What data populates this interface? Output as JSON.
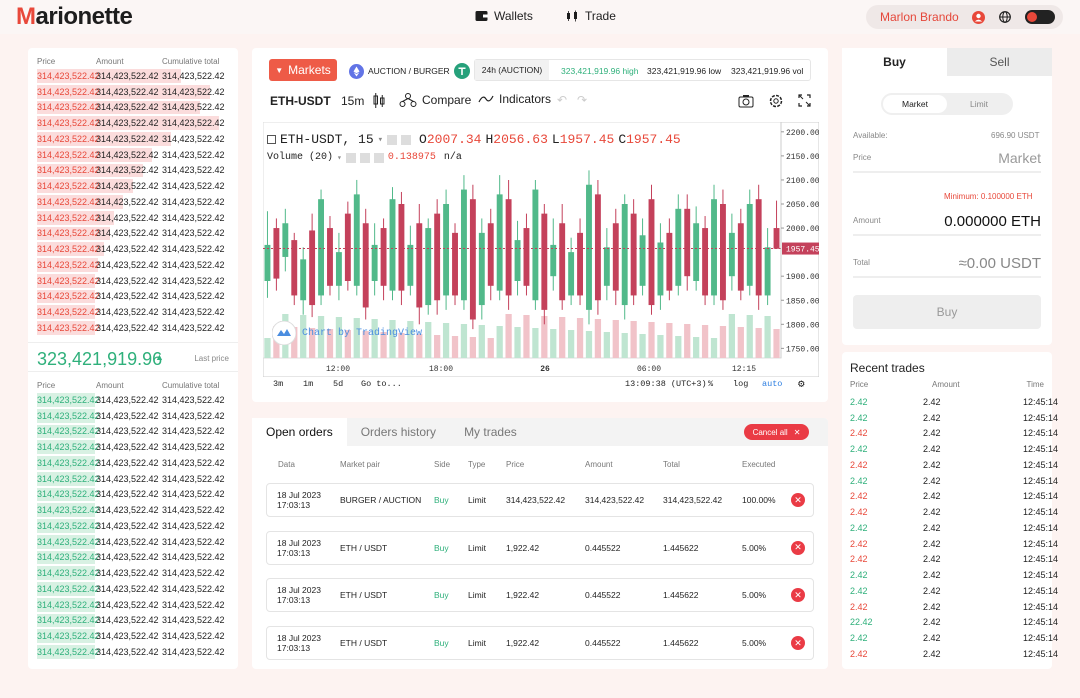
{
  "app": {
    "logo": "Marionette"
  },
  "nav": {
    "wallets": "Wallets",
    "trade": "Trade"
  },
  "user": {
    "name": "Marlon Brando"
  },
  "orderbook": {
    "columns": [
      "Price",
      "Amount",
      "Cumulative total"
    ],
    "asks": [
      {
        "price": "314,423,522.42",
        "amount": "314,423,522.42",
        "total": "314,423,522.42",
        "depth": 0.75
      },
      {
        "price": "314,423,522.42",
        "amount": "314,423,522.42",
        "total": "314,423,522.42",
        "depth": 0.9
      },
      {
        "price": "314,423,522.42",
        "amount": "314,423,522.42",
        "total": "314,423,522.42",
        "depth": 0.85
      },
      {
        "price": "314,423,522.42",
        "amount": "314,423,522.42",
        "total": "314,423,522.42",
        "depth": 0.95
      },
      {
        "price": "314,423,522.42",
        "amount": "314,423,522.42",
        "total": "314,423,522.42",
        "depth": 0.7
      },
      {
        "price": "314,423,522.42",
        "amount": "314,423,522.42",
        "total": "314,423,522.42",
        "depth": 0.6
      },
      {
        "price": "314,423,522.42",
        "amount": "314,423,522.42",
        "total": "314,423,522.42",
        "depth": 0.55
      },
      {
        "price": "314,423,522.42",
        "amount": "314,423,522.42",
        "total": "314,423,522.42",
        "depth": 0.5
      },
      {
        "price": "314,423,522.42",
        "amount": "314,423,522.42",
        "total": "314,423,522.42",
        "depth": 0.45
      },
      {
        "price": "314,423,522.42",
        "amount": "314,423,522.42",
        "total": "314,423,522.42",
        "depth": 0.4
      },
      {
        "price": "314,423,522.42",
        "amount": "314,423,522.42",
        "total": "314,423,522.42",
        "depth": 0.38
      },
      {
        "price": "314,423,522.42",
        "amount": "314,423,522.42",
        "total": "314,423,522.42",
        "depth": 0.35
      },
      {
        "price": "314,423,522.42",
        "amount": "314,423,522.42",
        "total": "314,423,522.42",
        "depth": 0.32
      },
      {
        "price": "314,423,522.42",
        "amount": "314,423,522.42",
        "total": "314,423,522.42",
        "depth": 0.3
      },
      {
        "price": "314,423,522.42",
        "amount": "314,423,522.42",
        "total": "314,423,522.42",
        "depth": 0.3
      },
      {
        "price": "314,423,522.42",
        "amount": "314,423,522.42",
        "total": "314,423,522.42",
        "depth": 0.3
      },
      {
        "price": "314,423,522.42",
        "amount": "314,423,522.42",
        "total": "314,423,522.42",
        "depth": 0.3
      }
    ],
    "last_price": "323,421,919.96",
    "last_price_label": "Last price",
    "bids": [
      {
        "price": "314,423,522.42",
        "amount": "314,423,522.42",
        "total": "314,423,522.42",
        "depth": 0.3
      },
      {
        "price": "314,423,522.42",
        "amount": "314,423,522.42",
        "total": "314,423,522.42",
        "depth": 0.3
      },
      {
        "price": "314,423,522.42",
        "amount": "314,423,522.42",
        "total": "314,423,522.42",
        "depth": 0.3
      },
      {
        "price": "314,423,522.42",
        "amount": "314,423,522.42",
        "total": "314,423,522.42",
        "depth": 0.3
      },
      {
        "price": "314,423,522.42",
        "amount": "314,423,522.42",
        "total": "314,423,522.42",
        "depth": 0.3
      },
      {
        "price": "314,423,522.42",
        "amount": "314,423,522.42",
        "total": "314,423,522.42",
        "depth": 0.3
      },
      {
        "price": "314,423,522.42",
        "amount": "314,423,522.42",
        "total": "314,423,522.42",
        "depth": 0.3
      },
      {
        "price": "314,423,522.42",
        "amount": "314,423,522.42",
        "total": "314,423,522.42",
        "depth": 0.3
      },
      {
        "price": "314,423,522.42",
        "amount": "314,423,522.42",
        "total": "314,423,522.42",
        "depth": 0.3
      },
      {
        "price": "314,423,522.42",
        "amount": "314,423,522.42",
        "total": "314,423,522.42",
        "depth": 0.3
      },
      {
        "price": "314,423,522.42",
        "amount": "314,423,522.42",
        "total": "314,423,522.42",
        "depth": 0.3
      },
      {
        "price": "314,423,522.42",
        "amount": "314,423,522.42",
        "total": "314,423,522.42",
        "depth": 0.3
      },
      {
        "price": "314,423,522.42",
        "amount": "314,423,522.42",
        "total": "314,423,522.42",
        "depth": 0.3
      },
      {
        "price": "314,423,522.42",
        "amount": "314,423,522.42",
        "total": "314,423,522.42",
        "depth": 0.3
      },
      {
        "price": "314,423,522.42",
        "amount": "314,423,522.42",
        "total": "314,423,522.42",
        "depth": 0.3
      },
      {
        "price": "314,423,522.42",
        "amount": "314,423,522.42",
        "total": "314,423,522.42",
        "depth": 0.3
      },
      {
        "price": "314,423,522.42",
        "amount": "314,423,522.42",
        "total": "314,423,522.42",
        "depth": 0.3
      }
    ]
  },
  "market_bar": {
    "markets_button": "Markets",
    "pair": "AUCTION / BURGER",
    "stats_label": "24h (AUCTION)",
    "high": "323,421,919.96 high",
    "low": "323,421,919.96 low",
    "vol": "323,421,919.96 vol"
  },
  "chart_toolbar": {
    "symbol": "ETH-USDT",
    "interval": "15m",
    "compare": "Compare",
    "indicators": "Indicators"
  },
  "chart_legend": {
    "symbol": "ETH-USDT, 15",
    "o_label": "O",
    "o": "2007.34",
    "h_label": "H",
    "h": "2056.63",
    "l_label": "L",
    "l": "1957.45",
    "c_label": "C",
    "c": "1957.45",
    "volume": "Volume (20)",
    "vol_value": "0.138975",
    "vol_na": "n/a",
    "watermark": "Chart by TradingView"
  },
  "chart_bottom": {
    "ranges": [
      "3m",
      "1m",
      "5d"
    ],
    "goto": "Go to...",
    "time": "13:09:38 (UTC+3)",
    "pct": "%",
    "log": "log",
    "auto": "auto"
  },
  "chart_data": {
    "type": "candlestick",
    "y_ticks": [
      "2200.00",
      "2150.00",
      "2100.00",
      "2050.00",
      "2000.00",
      "1957.45",
      "1900.00",
      "1850.00",
      "1800.00",
      "1750.00"
    ],
    "x_ticks": [
      "12:00",
      "18:00",
      "26",
      "06:00",
      "12:15"
    ],
    "ylim": [
      1730,
      2210
    ],
    "last_price": "1957.45",
    "candles": [
      {
        "o": 1890,
        "c": 1965,
        "h": 2035,
        "l": 1855
      },
      {
        "o": 2000,
        "c": 1895,
        "h": 2020,
        "l": 1870
      },
      {
        "o": 1940,
        "c": 2010,
        "h": 2040,
        "l": 1910
      },
      {
        "o": 1975,
        "c": 1860,
        "h": 1990,
        "l": 1840
      },
      {
        "o": 1850,
        "c": 1935,
        "h": 1960,
        "l": 1820
      },
      {
        "o": 1995,
        "c": 1840,
        "h": 2030,
        "l": 1815
      },
      {
        "o": 1860,
        "c": 2060,
        "h": 2080,
        "l": 1840
      },
      {
        "o": 2000,
        "c": 1880,
        "h": 2025,
        "l": 1860
      },
      {
        "o": 1880,
        "c": 1950,
        "h": 1990,
        "l": 1850
      },
      {
        "o": 2030,
        "c": 1890,
        "h": 2055,
        "l": 1870
      },
      {
        "o": 1880,
        "c": 2070,
        "h": 2100,
        "l": 1860
      },
      {
        "o": 2010,
        "c": 1835,
        "h": 2040,
        "l": 1810
      },
      {
        "o": 1890,
        "c": 1965,
        "h": 2010,
        "l": 1860
      },
      {
        "o": 2000,
        "c": 1880,
        "h": 2020,
        "l": 1850
      },
      {
        "o": 1870,
        "c": 2060,
        "h": 2085,
        "l": 1850
      },
      {
        "o": 2050,
        "c": 1870,
        "h": 2075,
        "l": 1840
      },
      {
        "o": 1880,
        "c": 1965,
        "h": 2005,
        "l": 1860
      },
      {
        "o": 2010,
        "c": 1835,
        "h": 2050,
        "l": 1800
      },
      {
        "o": 1840,
        "c": 2000,
        "h": 2020,
        "l": 1820
      },
      {
        "o": 2030,
        "c": 1850,
        "h": 2060,
        "l": 1820
      },
      {
        "o": 1860,
        "c": 2050,
        "h": 2080,
        "l": 1830
      },
      {
        "o": 1990,
        "c": 1860,
        "h": 2010,
        "l": 1840
      },
      {
        "o": 1850,
        "c": 2080,
        "h": 2110,
        "l": 1830
      },
      {
        "o": 2060,
        "c": 1810,
        "h": 2090,
        "l": 1790
      },
      {
        "o": 1840,
        "c": 1990,
        "h": 2020,
        "l": 1810
      },
      {
        "o": 2010,
        "c": 1880,
        "h": 2040,
        "l": 1850
      },
      {
        "o": 1870,
        "c": 2070,
        "h": 2110,
        "l": 1850
      },
      {
        "o": 2060,
        "c": 1860,
        "h": 2100,
        "l": 1830
      },
      {
        "o": 1890,
        "c": 1975,
        "h": 2015,
        "l": 1860
      },
      {
        "o": 2000,
        "c": 1880,
        "h": 2030,
        "l": 1860
      },
      {
        "o": 1850,
        "c": 2080,
        "h": 2100,
        "l": 1830
      },
      {
        "o": 2030,
        "c": 1830,
        "h": 2050,
        "l": 1800
      },
      {
        "o": 1900,
        "c": 1965,
        "h": 2020,
        "l": 1870
      },
      {
        "o": 2010,
        "c": 1850,
        "h": 2050,
        "l": 1830
      },
      {
        "o": 1860,
        "c": 1950,
        "h": 1980,
        "l": 1840
      },
      {
        "o": 1990,
        "c": 1860,
        "h": 2020,
        "l": 1840
      },
      {
        "o": 1830,
        "c": 2090,
        "h": 2120,
        "l": 1800
      },
      {
        "o": 2070,
        "c": 1850,
        "h": 2100,
        "l": 1820
      },
      {
        "o": 1880,
        "c": 1960,
        "h": 2000,
        "l": 1850
      },
      {
        "o": 2010,
        "c": 1870,
        "h": 2040,
        "l": 1840
      },
      {
        "o": 1840,
        "c": 2050,
        "h": 2070,
        "l": 1810
      },
      {
        "o": 2030,
        "c": 1860,
        "h": 2060,
        "l": 1840
      },
      {
        "o": 1880,
        "c": 1985,
        "h": 2020,
        "l": 1860
      },
      {
        "o": 2060,
        "c": 1840,
        "h": 2090,
        "l": 1820
      },
      {
        "o": 1860,
        "c": 1970,
        "h": 2010,
        "l": 1830
      },
      {
        "o": 1990,
        "c": 1870,
        "h": 2020,
        "l": 1850
      },
      {
        "o": 1880,
        "c": 2040,
        "h": 2070,
        "l": 1860
      },
      {
        "o": 2040,
        "c": 1900,
        "h": 2070,
        "l": 1870
      },
      {
        "o": 1890,
        "c": 2010,
        "h": 2045,
        "l": 1870
      },
      {
        "o": 2000,
        "c": 1860,
        "h": 2025,
        "l": 1840
      },
      {
        "o": 1860,
        "c": 2060,
        "h": 2090,
        "l": 1840
      },
      {
        "o": 2050,
        "c": 1850,
        "h": 2080,
        "l": 1830
      },
      {
        "o": 1900,
        "c": 1990,
        "h": 2030,
        "l": 1870
      },
      {
        "o": 2010,
        "c": 1870,
        "h": 2040,
        "l": 1850
      },
      {
        "o": 1880,
        "c": 2050,
        "h": 2080,
        "l": 1860
      },
      {
        "o": 2060,
        "c": 1860,
        "h": 2090,
        "l": 1830
      },
      {
        "o": 1860,
        "c": 1960,
        "h": 2000,
        "l": 1840
      },
      {
        "o": 2000,
        "c": 1957,
        "h": 2057,
        "l": 1957
      }
    ]
  },
  "orders": {
    "tabs": [
      "Open orders",
      "Orders history",
      "My trades"
    ],
    "cancel_all": "Cancel all",
    "columns": [
      "Data",
      "Market pair",
      "Side",
      "Type",
      "Price",
      "Amount",
      "Total",
      "Executed"
    ],
    "rows": [
      {
        "date": "18 Jul 2023",
        "time": "17:03:13",
        "pair": "BURGER / AUCTION",
        "side": "Buy",
        "type": "Limit",
        "price": "314,423,522.42",
        "amount": "314,423,522.42",
        "total": "314,423,522.42",
        "executed": "100.00%"
      },
      {
        "date": "18 Jul 2023",
        "time": "17:03:13",
        "pair": "ETH / USDT",
        "side": "Buy",
        "type": "Limit",
        "price": "1,922.42",
        "amount": "0.445522",
        "total": "1.445622",
        "executed": "5.00%"
      },
      {
        "date": "18 Jul 2023",
        "time": "17:03:13",
        "pair": "ETH / USDT",
        "side": "Buy",
        "type": "Limit",
        "price": "1,922.42",
        "amount": "0.445522",
        "total": "1.445622",
        "executed": "5.00%"
      },
      {
        "date": "18 Jul 2023",
        "time": "17:03:13",
        "pair": "ETH / USDT",
        "side": "Buy",
        "type": "Limit",
        "price": "1,922.42",
        "amount": "0.445522",
        "total": "1.445622",
        "executed": "5.00%"
      }
    ]
  },
  "trade_form": {
    "buy_tab": "Buy",
    "sell_tab": "Sell",
    "market_toggle": "Market",
    "limit_toggle": "Limit",
    "available_label": "Available:",
    "available_value": "696.90 USDT",
    "price_label": "Price",
    "price_value": "Market",
    "minimum": "Minimum: 0.100000 ETH",
    "amount_label": "Amount",
    "amount_value": "0.000000 ETH",
    "total_label": "Total",
    "total_value": "≈0.00 USDT",
    "submit": "Buy"
  },
  "recent_trades": {
    "title": "Recent trades",
    "columns": [
      "Price",
      "Amount",
      "Time"
    ],
    "rows": [
      {
        "price": "2.42",
        "amount": "2.42",
        "time": "12:45:14",
        "dir": "up"
      },
      {
        "price": "2.42",
        "amount": "2.42",
        "time": "12:45:14",
        "dir": "up"
      },
      {
        "price": "2.42",
        "amount": "2.42",
        "time": "12:45:14",
        "dir": "dn"
      },
      {
        "price": "2.42",
        "amount": "2.42",
        "time": "12:45:14",
        "dir": "up"
      },
      {
        "price": "2.42",
        "amount": "2.42",
        "time": "12:45:14",
        "dir": "dn"
      },
      {
        "price": "2.42",
        "amount": "2.42",
        "time": "12:45:14",
        "dir": "up"
      },
      {
        "price": "2.42",
        "amount": "2.42",
        "time": "12:45:14",
        "dir": "dn"
      },
      {
        "price": "2.42",
        "amount": "2.42",
        "time": "12:45:14",
        "dir": "dn"
      },
      {
        "price": "2.42",
        "amount": "2.42",
        "time": "12:45:14",
        "dir": "up"
      },
      {
        "price": "2.42",
        "amount": "2.42",
        "time": "12:45:14",
        "dir": "dn"
      },
      {
        "price": "2.42",
        "amount": "2.42",
        "time": "12:45:14",
        "dir": "dn"
      },
      {
        "price": "2.42",
        "amount": "2.42",
        "time": "12:45:14",
        "dir": "up"
      },
      {
        "price": "2.42",
        "amount": "2.42",
        "time": "12:45:14",
        "dir": "up"
      },
      {
        "price": "2.42",
        "amount": "2.42",
        "time": "12:45:14",
        "dir": "dn"
      },
      {
        "price": "22.42",
        "amount": "2.42",
        "time": "12:45:14",
        "dir": "up"
      },
      {
        "price": "2.42",
        "amount": "2.42",
        "time": "12:45:14",
        "dir": "up"
      },
      {
        "price": "2.42",
        "amount": "2.42",
        "time": "12:45:14",
        "dir": "dn"
      }
    ]
  },
  "colors": {
    "accent": "#ee5b47",
    "up": "#2fb07b",
    "down": "#e8483a"
  }
}
